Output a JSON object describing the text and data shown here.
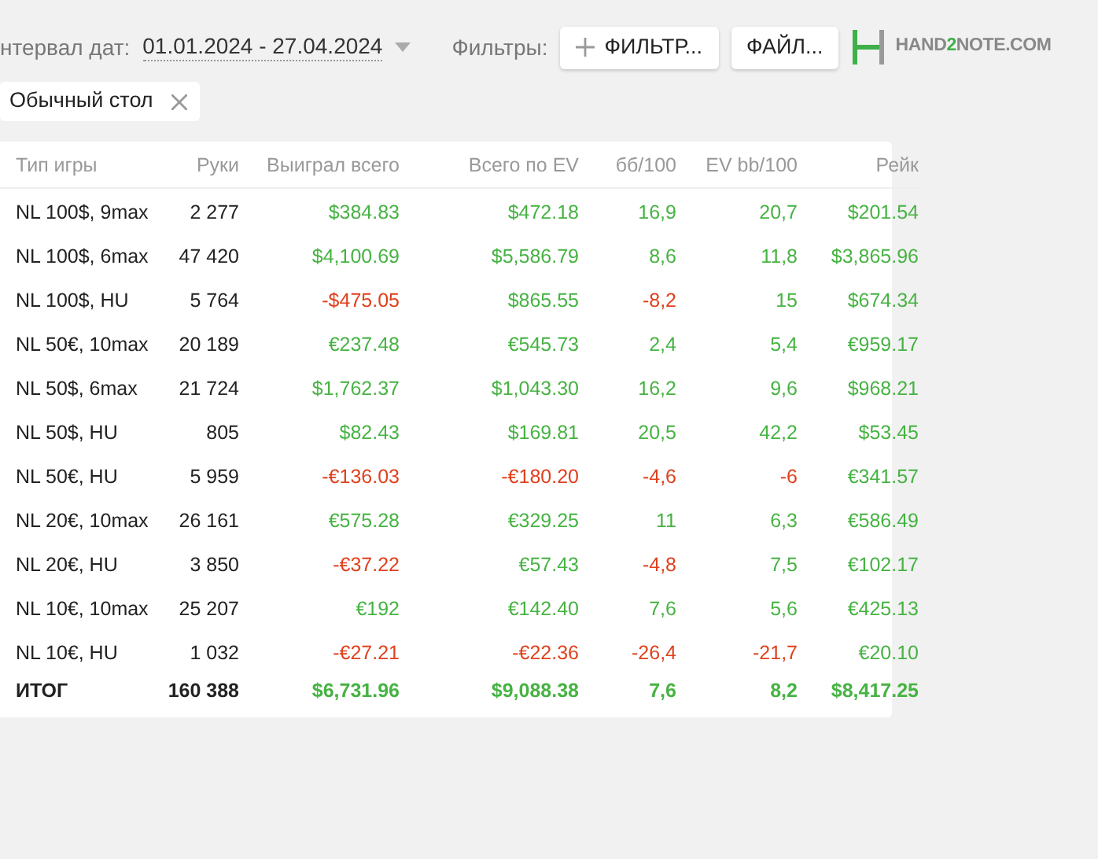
{
  "toolbar": {
    "date_label": "нтервал дат:",
    "date_range": "01.01.2024 - 27.04.2024",
    "filters_label": "Фильтры:",
    "filter_button": "ФИЛЬТР...",
    "file_button": "ФАЙЛ...",
    "logo": {
      "part_1": "HAND",
      "part_2": "2",
      "part_3": "NOTE.COM"
    }
  },
  "active_filters": [
    {
      "label": "Обычный стол"
    }
  ],
  "table": {
    "columns": [
      "Тип игры",
      "Руки",
      "Выиграл всего",
      "Всего по EV",
      "бб/100",
      "EV bb/100",
      "Рейк"
    ],
    "rows": [
      {
        "kind": "row",
        "cells": [
          {
            "text": "NL 100$, 9max"
          },
          {
            "text": "2 277"
          },
          {
            "text": "$384.83",
            "negative": false
          },
          {
            "text": "$472.18",
            "negative": false
          },
          {
            "text": "16,9",
            "negative": false
          },
          {
            "text": "20,7",
            "negative": false
          },
          {
            "text": "$201.54",
            "negative": false
          }
        ]
      },
      {
        "kind": "row",
        "cells": [
          {
            "text": "NL 100$, 6max"
          },
          {
            "text": "47 420"
          },
          {
            "text": "$4,100.69",
            "negative": false
          },
          {
            "text": "$5,586.79",
            "negative": false
          },
          {
            "text": "8,6",
            "negative": false
          },
          {
            "text": "11,8",
            "negative": false
          },
          {
            "text": "$3,865.96",
            "negative": false
          }
        ]
      },
      {
        "kind": "row",
        "cells": [
          {
            "text": "NL 100$, HU"
          },
          {
            "text": "5 764"
          },
          {
            "text": "-$475.05",
            "negative": true
          },
          {
            "text": "$865.55",
            "negative": false
          },
          {
            "text": "-8,2",
            "negative": true
          },
          {
            "text": "15",
            "negative": false
          },
          {
            "text": "$674.34",
            "negative": false
          }
        ]
      },
      {
        "kind": "row",
        "cells": [
          {
            "text": "NL 50€, 10max"
          },
          {
            "text": "20 189"
          },
          {
            "text": "€237.48",
            "negative": false
          },
          {
            "text": "€545.73",
            "negative": false
          },
          {
            "text": "2,4",
            "negative": false
          },
          {
            "text": "5,4",
            "negative": false
          },
          {
            "text": "€959.17",
            "negative": false
          }
        ]
      },
      {
        "kind": "row",
        "cells": [
          {
            "text": "NL 50$, 6max"
          },
          {
            "text": "21 724"
          },
          {
            "text": "$1,762.37",
            "negative": false
          },
          {
            "text": "$1,043.30",
            "negative": false
          },
          {
            "text": "16,2",
            "negative": false
          },
          {
            "text": "9,6",
            "negative": false
          },
          {
            "text": "$968.21",
            "negative": false
          }
        ]
      },
      {
        "kind": "row",
        "cells": [
          {
            "text": "NL 50$, HU"
          },
          {
            "text": "805"
          },
          {
            "text": "$82.43",
            "negative": false
          },
          {
            "text": "$169.81",
            "negative": false
          },
          {
            "text": "20,5",
            "negative": false
          },
          {
            "text": "42,2",
            "negative": false
          },
          {
            "text": "$53.45",
            "negative": false
          }
        ]
      },
      {
        "kind": "row",
        "cells": [
          {
            "text": "NL 50€, HU"
          },
          {
            "text": "5 959"
          },
          {
            "text": "-€136.03",
            "negative": true
          },
          {
            "text": "-€180.20",
            "negative": true
          },
          {
            "text": "-4,6",
            "negative": true
          },
          {
            "text": "-6",
            "negative": true
          },
          {
            "text": "€341.57",
            "negative": false
          }
        ]
      },
      {
        "kind": "row",
        "cells": [
          {
            "text": "NL 20€, 10max"
          },
          {
            "text": "26 161"
          },
          {
            "text": "€575.28",
            "negative": false
          },
          {
            "text": "€329.25",
            "negative": false
          },
          {
            "text": "11",
            "negative": false
          },
          {
            "text": "6,3",
            "negative": false
          },
          {
            "text": "€586.49",
            "negative": false
          }
        ]
      },
      {
        "kind": "row",
        "cells": [
          {
            "text": "NL 20€, HU"
          },
          {
            "text": "3 850"
          },
          {
            "text": "-€37.22",
            "negative": true
          },
          {
            "text": "€57.43",
            "negative": false
          },
          {
            "text": "-4,8",
            "negative": true
          },
          {
            "text": "7,5",
            "negative": false
          },
          {
            "text": "€102.17",
            "negative": false
          }
        ]
      },
      {
        "kind": "row",
        "cells": [
          {
            "text": "NL 10€, 10max"
          },
          {
            "text": "25 207"
          },
          {
            "text": "€192",
            "negative": false
          },
          {
            "text": "€142.40",
            "negative": false
          },
          {
            "text": "7,6",
            "negative": false
          },
          {
            "text": "5,6",
            "negative": false
          },
          {
            "text": "€425.13",
            "negative": false
          }
        ]
      },
      {
        "kind": "row",
        "cells": [
          {
            "text": "NL 10€, HU"
          },
          {
            "text": "1 032"
          },
          {
            "text": "-€27.21",
            "negative": true
          },
          {
            "text": "-€22.36",
            "negative": true
          },
          {
            "text": "-26,4",
            "negative": true
          },
          {
            "text": "-21,7",
            "negative": true
          },
          {
            "text": "€20.10",
            "negative": false
          }
        ]
      },
      {
        "kind": "total",
        "cells": [
          {
            "text": "ИТОГ"
          },
          {
            "text": "160 388"
          },
          {
            "text": "$6,731.96",
            "negative": false
          },
          {
            "text": "$9,088.38",
            "negative": false
          },
          {
            "text": "7,6",
            "negative": false
          },
          {
            "text": "8,2",
            "negative": false
          },
          {
            "text": "$8,417.25",
            "negative": false
          }
        ]
      }
    ]
  }
}
